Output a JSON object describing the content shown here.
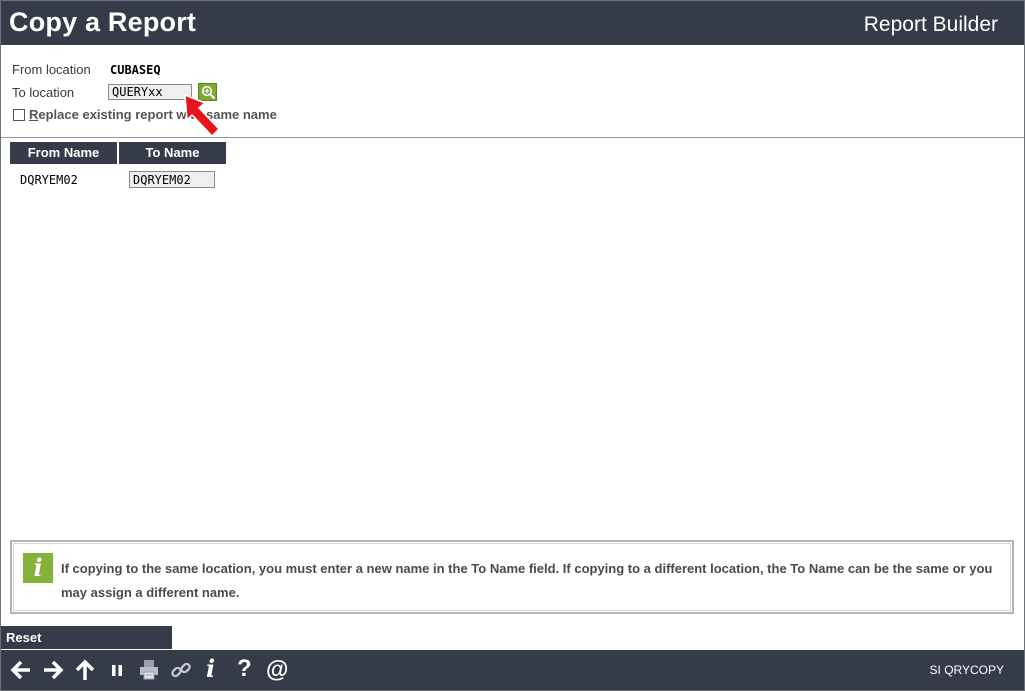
{
  "header": {
    "page_title": "Copy a Report",
    "app_title": "Report Builder"
  },
  "form": {
    "from_location_label": "From location",
    "from_location_value": "CUBASEQ",
    "to_location_label": "To location",
    "to_location_value": "QUERYxx",
    "prompt_icon": "magnifier-plus-icon",
    "replace_checkbox": {
      "checked": false,
      "mnemonic": "R",
      "label_rest": "eplace existing report with same name"
    }
  },
  "table": {
    "headers": [
      "From Name",
      "To Name"
    ],
    "rows": [
      {
        "from_name": "DQRYEM02",
        "to_name": "DQRYEM02"
      }
    ]
  },
  "info": {
    "icon": "info-icon",
    "icon_glyph": "i",
    "message": "If copying to the same location, you must enter a new name in the To Name field. If copying to a  different location, the To Name can be the same or you may assign a different name."
  },
  "function_keys": {
    "reset_label": "Reset"
  },
  "bottom_bar": {
    "icons": [
      "arrow-left-icon",
      "arrow-right-icon",
      "arrow-up-icon",
      "pause-icon",
      "printer-icon",
      "link-icon",
      "info-icon",
      "help-icon",
      "at-sign-icon"
    ],
    "info_glyph": "i",
    "help_glyph": "?",
    "at_glyph": "@",
    "screen_id": "SI QRYCOPY"
  },
  "colors": {
    "bar_background": "#353b48",
    "accent_green": "#86b13d",
    "annotation_red": "#e8141b"
  }
}
